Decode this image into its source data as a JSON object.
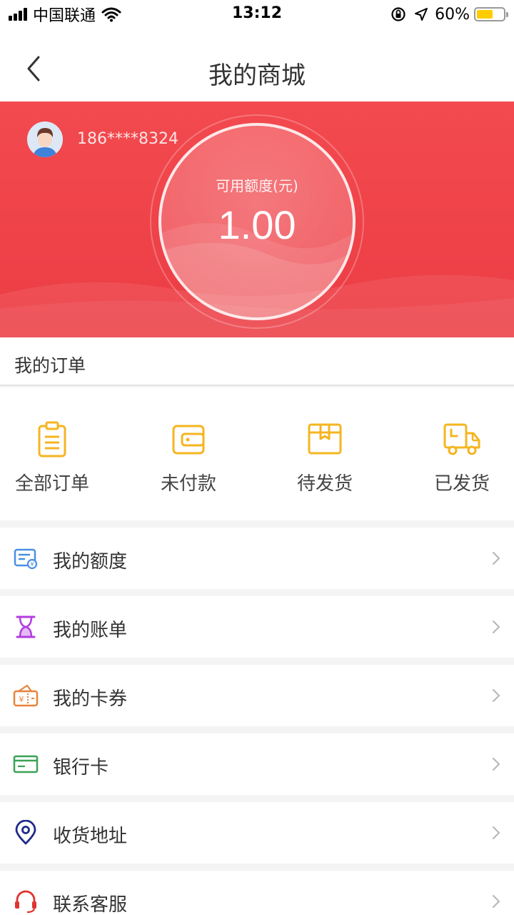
{
  "status_bar": {
    "carrier": "中国联通",
    "time": "13:12",
    "battery": "60%",
    "battery_level": 0.6
  },
  "nav": {
    "title": "我的商城"
  },
  "account": {
    "phone": "186****8324"
  },
  "credit": {
    "label": "可用额度(元)",
    "value": "1.00"
  },
  "orders": {
    "title": "我的订单",
    "items": [
      {
        "label": "全部订单",
        "icon": "clipboard-icon"
      },
      {
        "label": "未付款",
        "icon": "wallet-icon"
      },
      {
        "label": "待发货",
        "icon": "package-icon"
      },
      {
        "label": "已发货",
        "icon": "delivery-truck-icon"
      }
    ]
  },
  "menu": [
    {
      "label": "我的额度",
      "icon": "credit-card-icon",
      "color": "#4a90e2"
    },
    {
      "label": "我的账单",
      "icon": "hourglass-icon",
      "color": "#b33de0"
    },
    {
      "label": "我的卡券",
      "icon": "coupon-icon",
      "color": "#e8823a"
    },
    {
      "label": "银行卡",
      "icon": "bank-card-icon",
      "color": "#3aa356"
    },
    {
      "label": "收货地址",
      "icon": "location-pin-icon",
      "color": "#1e2a8a"
    },
    {
      "label": "联系客服",
      "icon": "headset-icon",
      "color": "#e0342f"
    }
  ],
  "colors": {
    "brand_red": "#ec3c44",
    "order_icon": "#f5b520"
  }
}
